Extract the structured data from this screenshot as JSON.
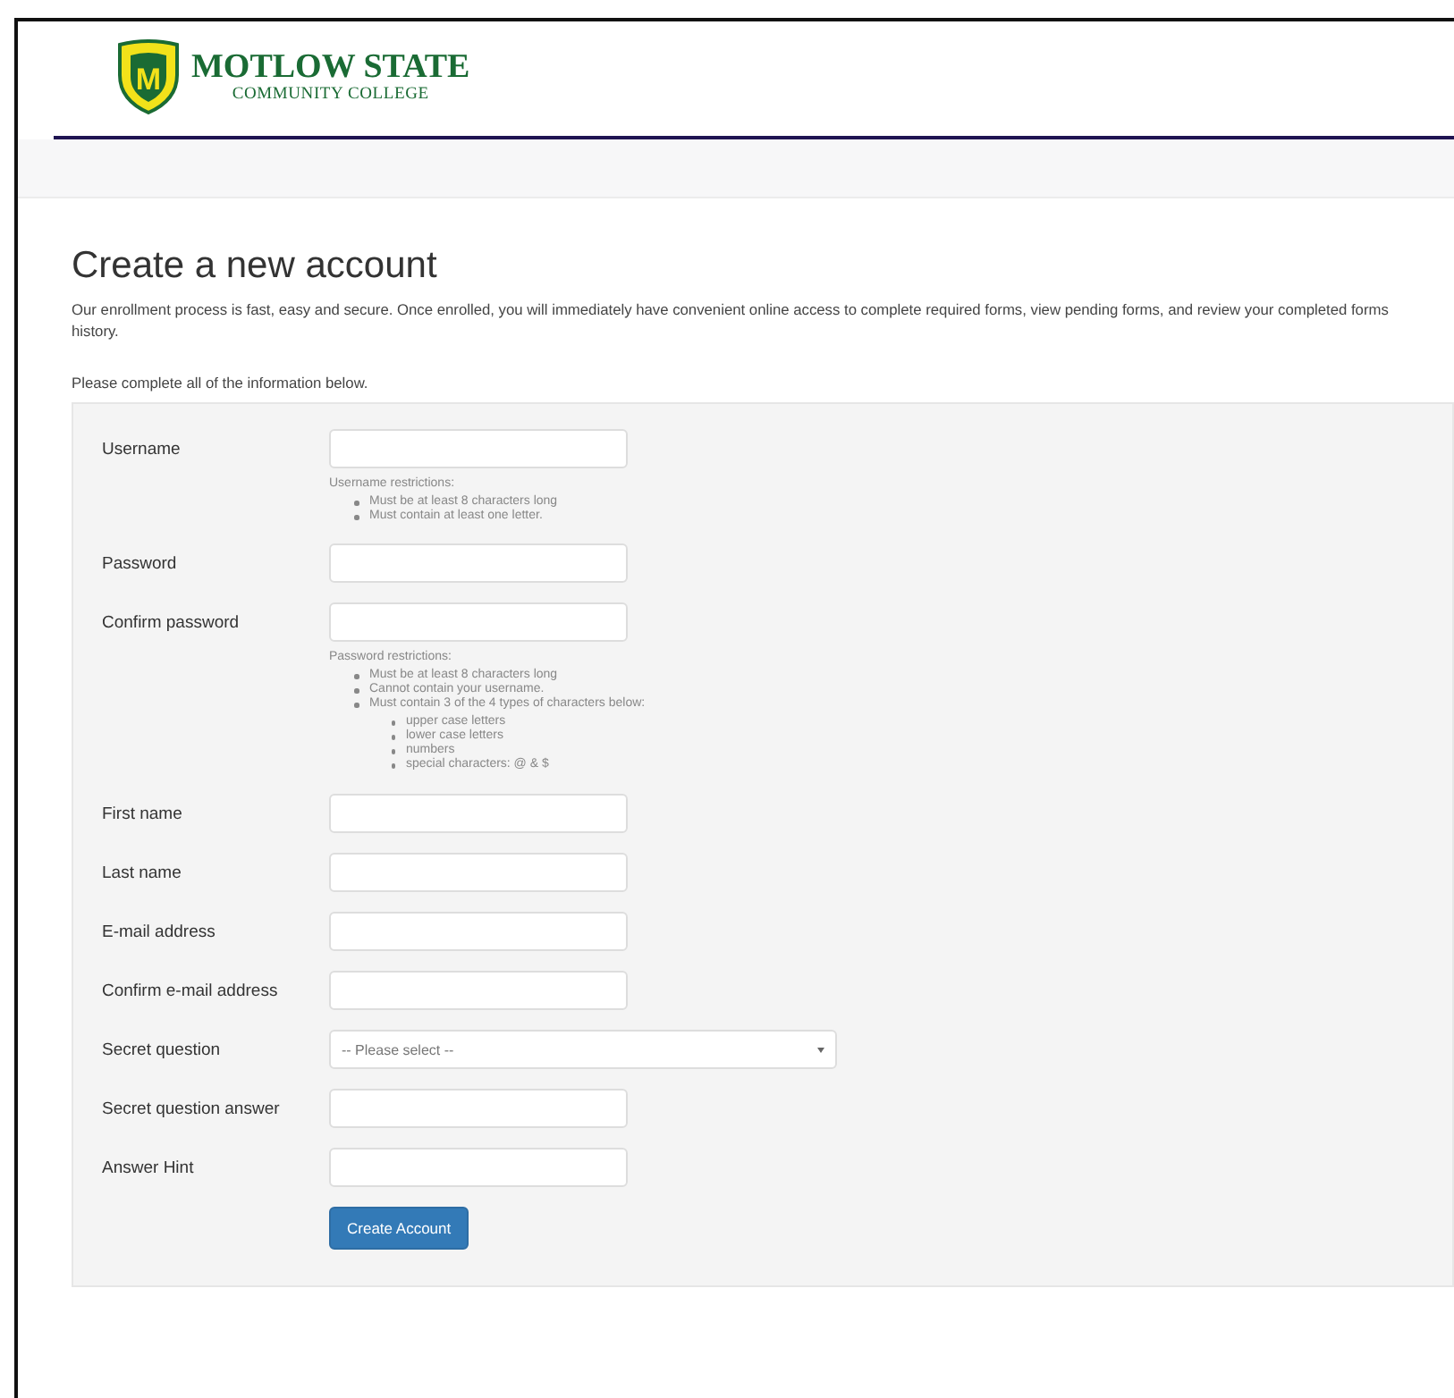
{
  "logo": {
    "mark": "M",
    "name": "MOTLOW STATE",
    "subtitle": "COMMUNITY COLLEGE"
  },
  "heading": "Create a new account",
  "intro": "Our enrollment process is fast, easy and secure. Once enrolled, you will immediately have convenient online access to complete required forms, view pending forms, and review your completed forms history.",
  "instruction": "Please complete all of the information below.",
  "fields": [
    {
      "kind": "text",
      "label": "Username",
      "help": {
        "title": "Username restrictions:",
        "items": [
          {
            "text": "Must be at least 8 characters long"
          },
          {
            "text": "Must contain at least one letter."
          }
        ]
      }
    },
    {
      "kind": "text",
      "label": "Password"
    },
    {
      "kind": "text",
      "label": "Confirm password",
      "help": {
        "title": "Password restrictions:",
        "items": [
          {
            "text": "Must be at least 8 characters long"
          },
          {
            "text": "Cannot contain your username."
          },
          {
            "text": "Must contain 3 of the 4 types of characters below:",
            "children": [
              {
                "text": "upper case letters"
              },
              {
                "text": "lower case letters"
              },
              {
                "text": "numbers"
              },
              {
                "text": "special characters: @ & $"
              }
            ]
          }
        ]
      }
    },
    {
      "kind": "text",
      "label": "First name"
    },
    {
      "kind": "text",
      "label": "Last name"
    },
    {
      "kind": "text",
      "label": "E-mail address"
    },
    {
      "kind": "text",
      "label": "Confirm e-mail address"
    },
    {
      "kind": "select",
      "label": "Secret question",
      "placeholder": "-- Please select --"
    },
    {
      "kind": "text",
      "label": "Secret question answer"
    },
    {
      "kind": "text",
      "label": "Answer Hint"
    }
  ],
  "button": "Create Account"
}
